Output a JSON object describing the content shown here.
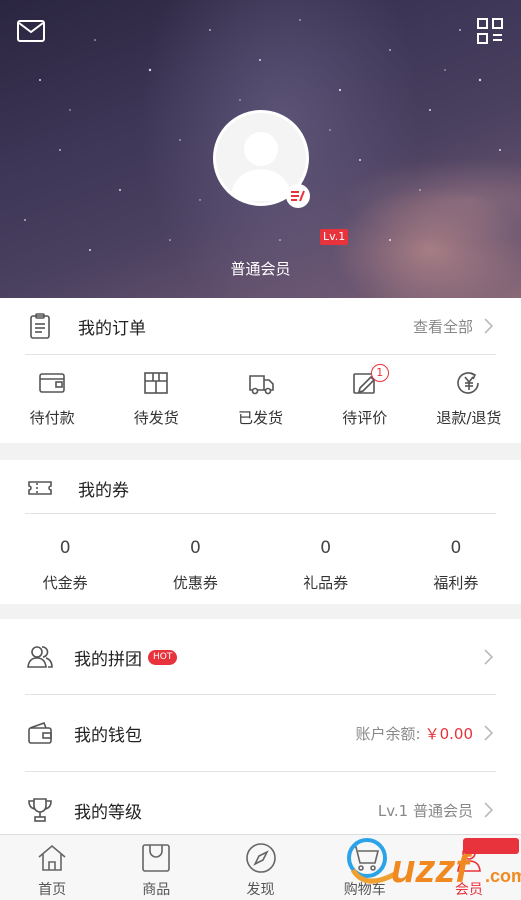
{
  "header": {
    "member_level_tag": "Lv.1",
    "member_name": "普通会员"
  },
  "orders": {
    "title": "我的订单",
    "view_all": "查看全部",
    "items": [
      {
        "label": "待付款",
        "icon": "wallet-icon",
        "badge": ""
      },
      {
        "label": "待发货",
        "icon": "package-icon",
        "badge": ""
      },
      {
        "label": "已发货",
        "icon": "truck-icon",
        "badge": ""
      },
      {
        "label": "待评价",
        "icon": "pen-review-icon",
        "badge": "1"
      },
      {
        "label": "退款/退货",
        "icon": "refund-yen-icon",
        "badge": ""
      }
    ]
  },
  "coupons": {
    "title": "我的券",
    "items": [
      {
        "count": "0",
        "label": "代金券"
      },
      {
        "count": "0",
        "label": "优惠券"
      },
      {
        "count": "0",
        "label": "礼品券"
      },
      {
        "count": "0",
        "label": "福利券"
      }
    ]
  },
  "group_buy": {
    "label": "我的拼团",
    "tag": "HOT"
  },
  "wallet": {
    "label": "我的钱包",
    "balance_label": "账户余额:",
    "balance": "￥0.00"
  },
  "level": {
    "label": "我的等级",
    "value": "Lv.1 普通会员"
  },
  "tabbar": {
    "tabs": [
      {
        "label": "首页",
        "icon": "home-icon"
      },
      {
        "label": "商品",
        "icon": "shopping-bag-icon"
      },
      {
        "label": "发现",
        "icon": "compass-icon"
      },
      {
        "label": "购物车",
        "icon": "cart-icon"
      },
      {
        "label": "会员",
        "icon": "member-icon"
      }
    ],
    "active_index": 4
  },
  "colors": {
    "accent": "#e8323c"
  }
}
